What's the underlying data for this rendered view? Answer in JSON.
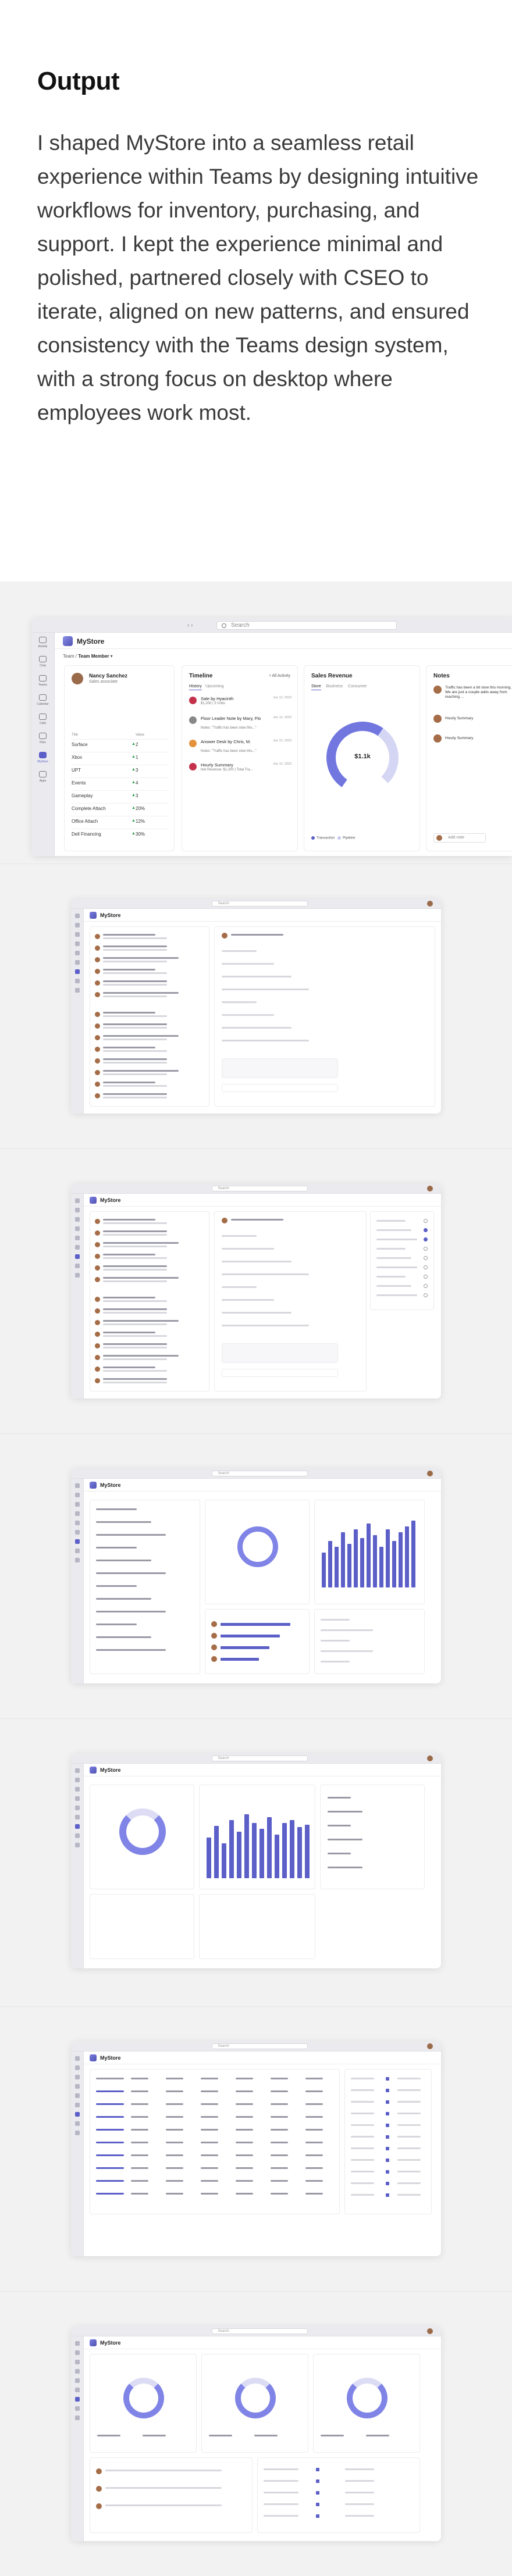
{
  "section": {
    "heading": "Output",
    "body": "I shaped MyStore into a seamless retail experience within Teams by designing intuitive workflows for inventory, purchasing, and support. I kept the experience minimal and polished, partnered closely with CSEO to iterate, aligned on new patterns, and ensured consistency with the Teams design system, with a strong focus on desktop where employees work most."
  },
  "main_shot": {
    "search_placeholder": "Search",
    "nav_arrows": "‹ ›",
    "app_name": "MyStore",
    "breadcrumb_prefix": "Team / ",
    "breadcrumb_current": "Team Member",
    "rail": [
      {
        "label": "Activity"
      },
      {
        "label": "Chat"
      },
      {
        "label": "Teams"
      },
      {
        "label": "Calendar"
      },
      {
        "label": "Calls"
      },
      {
        "label": "Files"
      },
      {
        "label": "MyStore",
        "active": true
      },
      {
        "label": "Apps"
      }
    ],
    "person": {
      "name": "Nancy Sanchez",
      "role": "Sales associate",
      "col_title": "Title",
      "col_value": "Value",
      "rows": [
        {
          "label": "Surface",
          "dir": "up",
          "value": "2"
        },
        {
          "label": "Xbox",
          "dir": "up",
          "value": "1"
        },
        {
          "label": "UPT",
          "dir": "up",
          "value": "3"
        },
        {
          "label": "Events",
          "dir": "up",
          "value": "4"
        },
        {
          "label": "Gameplay",
          "dir": "up",
          "value": "3"
        },
        {
          "label": "Complete Attach",
          "dir": "up",
          "value": "20%"
        },
        {
          "label": "Office Attach",
          "dir": "up",
          "value": "12%"
        },
        {
          "label": "Dell Financing",
          "dir": "up",
          "value": "30%"
        }
      ]
    },
    "timeline": {
      "title": "Timeline",
      "filter": "All Activity",
      "tabs": [
        "History",
        "Upcoming"
      ],
      "items": [
        {
          "title": "Sale by Hyacinth",
          "sub": "$1,200 | 3 Units",
          "time": "Jun 12, 2023",
          "color": "#c4314b"
        },
        {
          "title": "Floor Leader Note by Mary, Flo",
          "sub": "Notes: \"Traffic has been slow this...\"",
          "time": "Jun 12, 2023",
          "color": "#8a8886"
        },
        {
          "title": "Answer Desk by Chris, M.",
          "sub": "Notes: \"Traffic has been slow this...\"",
          "time": "Jun 12, 2023",
          "color": "#e3913a"
        },
        {
          "title": "Hourly Summary",
          "sub": "Net Revenue: $1,200 | Total Tra...",
          "time": "Jun 12, 2023",
          "color": "#c4314b"
        }
      ]
    },
    "revenue": {
      "title": "Sales Revenue",
      "tabs": [
        "Store",
        "Business",
        "Consumer"
      ],
      "value": "$1.1k",
      "legend": [
        "Transaction",
        "Pipeline"
      ]
    },
    "notes": {
      "title": "Notes",
      "items": [
        "Traffic has been a bit slow this morning. We are just a couple adds away from reaching ...",
        "Hourly Summary",
        "Hourly Summary"
      ],
      "add_label": "Add note"
    }
  },
  "thumb_search": "Search",
  "thumb_app_name": "MyStore",
  "colors": {
    "accent": "#5b5fc7",
    "gallery_bg": "#f2f2f2",
    "up": "#1d9a3f",
    "down": "#c4314b"
  }
}
